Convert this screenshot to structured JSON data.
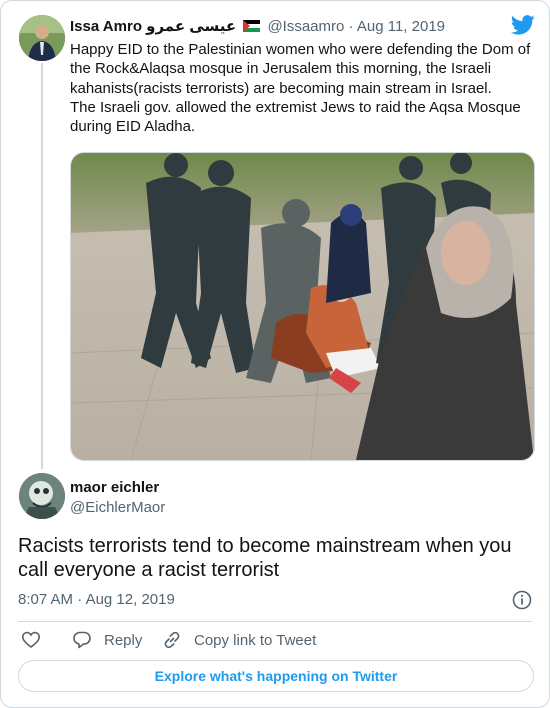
{
  "tweet": {
    "author_name": "Issa Amro",
    "author_arabic": "عيسى عمرو",
    "handle": "@Issaamro",
    "separator": "·",
    "date": "Aug 11, 2019",
    "text": "Happy EID to the Palestinian women who were defending the Dom of\nthe Rock&Alaqsa mosque in Jerusalem this morning, the Israeli\nkahanists(racists terrorists) are becoming main stream in Israel.\nThe Israeli gov. allowed the extremist Jews  to raid the Aqsa Mosque\nduring EID Aladha."
  },
  "reply": {
    "author_name": "maor eichler",
    "handle": "@EichlerMaor",
    "text": "Racists terrorists tend to become mainstream when you call everyone a racist terrorist",
    "time": "8:07 AM",
    "separator": "·",
    "date": "Aug 12, 2019"
  },
  "actions": {
    "reply_label": "Reply",
    "copy_label": "Copy link to Tweet"
  },
  "explore_label": "Explore what's happening on Twitter",
  "icons": [
    "palestine-flag-icon",
    "twitter-logo-icon",
    "info-icon",
    "heart-icon",
    "reply-icon",
    "link-icon"
  ],
  "colors": {
    "accent": "#1d9bf0",
    "muted": "#536471",
    "border": "#cfd9de",
    "text": "#0f1419"
  }
}
